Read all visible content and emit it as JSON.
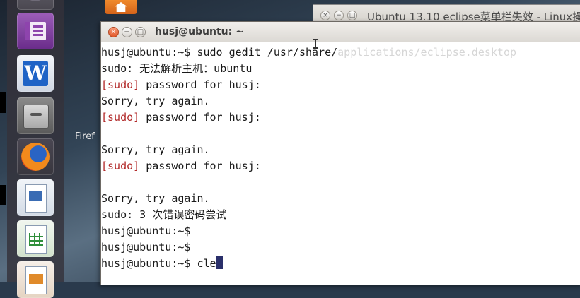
{
  "desktop": {
    "label": "Firef"
  },
  "launcher": {
    "items": [
      {
        "name": "disc",
        "icon": "disc-icon"
      },
      {
        "name": "purple-app",
        "icon": "app-icon"
      },
      {
        "name": "writer",
        "icon": "writer-icon",
        "glyph": "W"
      },
      {
        "name": "files",
        "icon": "files-icon"
      },
      {
        "name": "firefox",
        "icon": "firefox-icon"
      },
      {
        "name": "impress",
        "icon": "impress-icon"
      },
      {
        "name": "calc",
        "icon": "calc-icon"
      },
      {
        "name": "draw",
        "icon": "draw-icon"
      }
    ]
  },
  "background_window": {
    "title": "Ubuntu 13.10 eclipse菜单栏失效 - Linux操",
    "buttons": {
      "close": "×",
      "min": "−",
      "max": "□"
    }
  },
  "terminal": {
    "title": "husj@ubuntu: ~",
    "buttons": {
      "close": "×",
      "min": "−",
      "max": "□"
    },
    "lines": [
      {
        "text": "husj@ubuntu:~$ sudo gedit /usr/share/",
        "faded": "applications/eclipse.desktop"
      },
      {
        "text": "sudo: 无法解析主机：ubuntu"
      },
      {
        "prefix": "[sudo]",
        "text": " password for husj:"
      },
      {
        "text": "Sorry, try again."
      },
      {
        "prefix": "[sudo]",
        "text": " password for husj:"
      },
      {
        "text": ""
      },
      {
        "text": "Sorry, try again."
      },
      {
        "prefix": "[sudo]",
        "text": " password for husj:"
      },
      {
        "text": ""
      },
      {
        "text": "Sorry, try again."
      },
      {
        "text": "sudo: 3 次错误密码尝试"
      },
      {
        "text": "husj@ubuntu:~$"
      },
      {
        "text": "husj@ubuntu:~$"
      },
      {
        "text": "husj@ubuntu:~$ cle"
      }
    ]
  }
}
